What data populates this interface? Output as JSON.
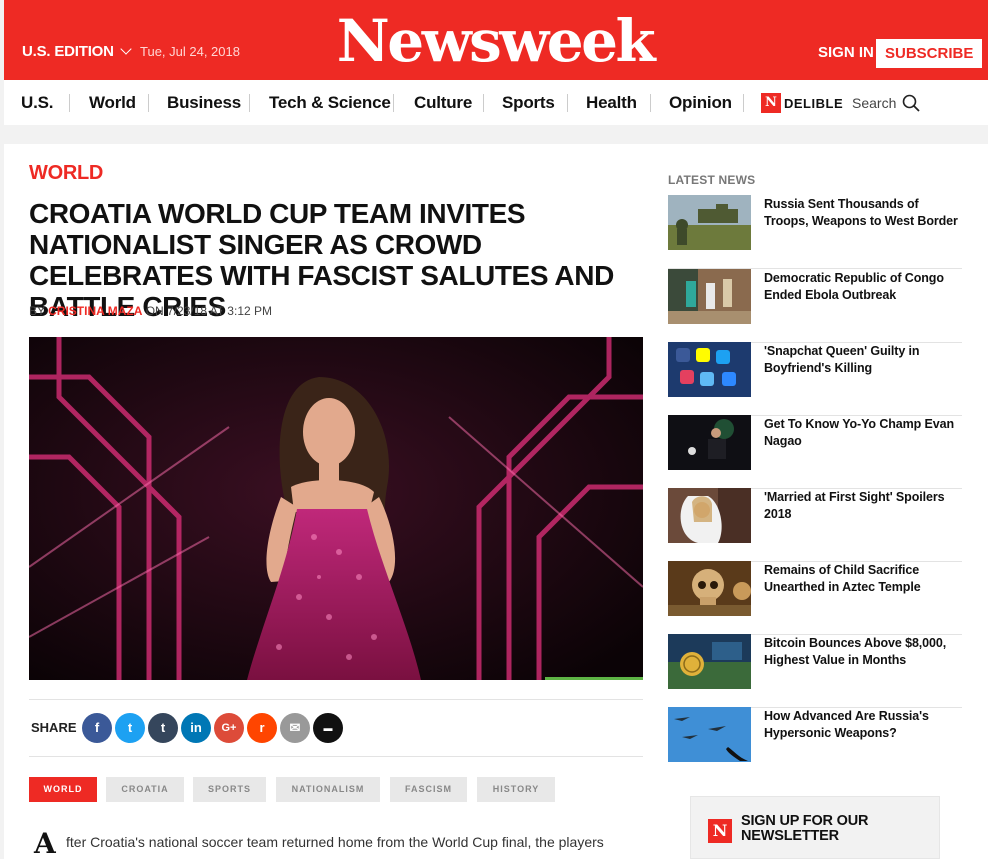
{
  "header": {
    "edition": "U.S. EDITION",
    "date": "Tue, Jul 24, 2018",
    "logo": "Newsweek",
    "sign_in": "SIGN IN",
    "subscribe": "SUBSCRIBE",
    "brand_color": "#ee2a24"
  },
  "nav": {
    "items": [
      "U.S.",
      "World",
      "Business",
      "Tech & Science",
      "Culture",
      "Sports",
      "Health",
      "Opinion"
    ],
    "indelible_mark": "N",
    "indelible_label": "DELIBLE",
    "search_label": "Search"
  },
  "article": {
    "category": "WORLD",
    "headline": "CROATIA WORLD CUP TEAM INVITES NATIONALIST SINGER AS CROWD CELEBRATES WITH FASCIST SALUTES AND BATTLE CRIES",
    "byline_prefix": "BY",
    "author": "CRISTINA MAZA",
    "byline_suffix": "ON 7/23/18 AT 3:12 PM",
    "video_progress": 0.16,
    "share_label": "SHARE",
    "share_buttons": [
      {
        "icon": "facebook-icon",
        "glyph": "f",
        "color": "#3b5998"
      },
      {
        "icon": "twitter-icon",
        "glyph": "t",
        "color": "#1da1f2"
      },
      {
        "icon": "tumblr-icon",
        "glyph": "t",
        "color": "#35465c"
      },
      {
        "icon": "linkedin-icon",
        "glyph": "in",
        "color": "#0077b5"
      },
      {
        "icon": "google-plus-icon",
        "glyph": "G+",
        "color": "#dd4b39"
      },
      {
        "icon": "reddit-icon",
        "glyph": "r",
        "color": "#ff4500"
      },
      {
        "icon": "email-icon",
        "glyph": "✉",
        "color": "#999999"
      },
      {
        "icon": "comment-icon",
        "glyph": "▬",
        "color": "#111111"
      }
    ],
    "tags": [
      "WORLD",
      "CROATIA",
      "SPORTS",
      "NATIONALISM",
      "FASCISM",
      "HISTORY"
    ],
    "dropcap": "A",
    "body_start": "fter Croatia's national soccer team returned home from the World Cup final, the players"
  },
  "sidebar": {
    "latest_label": "LATEST NEWS",
    "news": [
      {
        "title": "Russia Sent Thousands of Troops, Weapons to West Border"
      },
      {
        "title": "Democratic Republic of Congo Ended Ebola Outbreak"
      },
      {
        "title": "'Snapchat Queen' Guilty in Boyfriend's Killing"
      },
      {
        "title": "Get To Know Yo-Yo Champ Evan Nagao"
      },
      {
        "title": "'Married at First Sight' Spoilers 2018"
      },
      {
        "title": "Remains of Child Sacrifice Unearthed in Aztec Temple"
      },
      {
        "title": "Bitcoin Bounces Above $8,000, Highest Value in Months"
      },
      {
        "title": "How Advanced Are Russia's Hypersonic Weapons?"
      }
    ],
    "newsletter_mark": "N",
    "newsletter_label": "SIGN UP FOR OUR NEWSLETTER"
  }
}
